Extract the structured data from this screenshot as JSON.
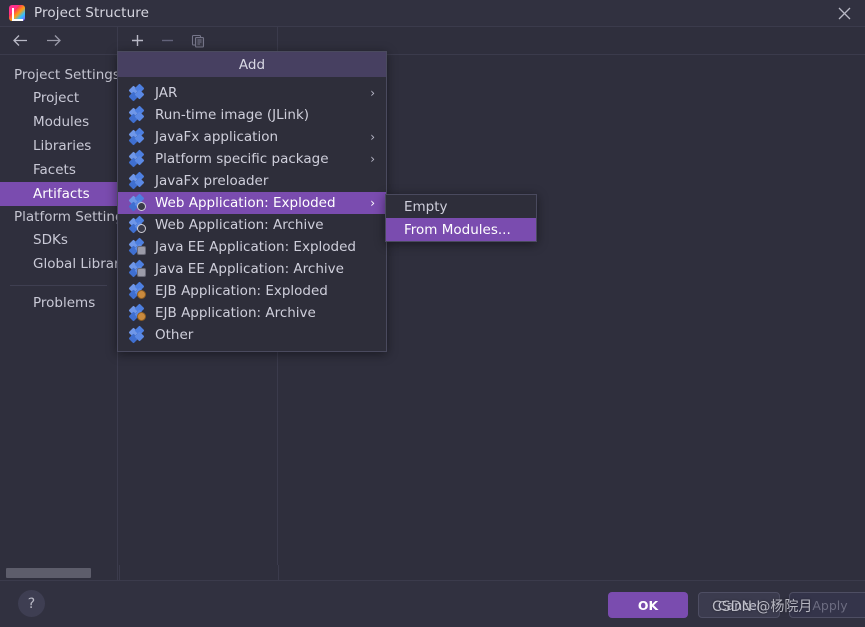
{
  "window": {
    "title": "Project Structure",
    "app_icon": "intellij-idea-icon",
    "close_icon": "close-icon"
  },
  "nav_toolbar": {
    "back_icon": "arrow-left-icon",
    "forward_icon": "arrow-right-icon"
  },
  "sidebar": {
    "groups": [
      {
        "label": "Project Settings",
        "items": [
          {
            "label": "Project",
            "selected": false
          },
          {
            "label": "Modules",
            "selected": false
          },
          {
            "label": "Libraries",
            "selected": false
          },
          {
            "label": "Facets",
            "selected": false
          },
          {
            "label": "Artifacts",
            "selected": true
          }
        ]
      },
      {
        "label": "Platform Settings",
        "items": [
          {
            "label": "SDKs",
            "selected": false
          },
          {
            "label": "Global Libraries",
            "selected": false
          }
        ]
      }
    ],
    "footer_item": {
      "label": "Problems",
      "selected": false
    }
  },
  "list_toolbar": {
    "add_icon": "plus-icon",
    "remove_icon": "minus-icon",
    "copy_icon": "copy-icon"
  },
  "add_menu": {
    "header": "Add",
    "items": [
      {
        "label": "JAR",
        "icon": "artifact-icon",
        "has_submenu": true,
        "selected": false,
        "badge": "none"
      },
      {
        "label": "Run-time image (JLink)",
        "icon": "artifact-icon",
        "has_submenu": false,
        "selected": false,
        "badge": "none"
      },
      {
        "label": "JavaFx application",
        "icon": "artifact-icon",
        "has_submenu": true,
        "selected": false,
        "badge": "none"
      },
      {
        "label": "Platform specific package",
        "icon": "artifact-icon",
        "has_submenu": true,
        "selected": false,
        "badge": "none"
      },
      {
        "label": "JavaFx preloader",
        "icon": "artifact-icon",
        "has_submenu": false,
        "selected": false,
        "badge": "none"
      },
      {
        "label": "Web Application: Exploded",
        "icon": "web-artifact-icon",
        "has_submenu": true,
        "selected": true,
        "badge": "web"
      },
      {
        "label": "Web Application: Archive",
        "icon": "web-artifact-icon",
        "has_submenu": false,
        "selected": false,
        "badge": "web"
      },
      {
        "label": "Java EE Application: Exploded",
        "icon": "javaee-artifact-icon",
        "has_submenu": false,
        "selected": false,
        "badge": "ee"
      },
      {
        "label": "Java EE Application: Archive",
        "icon": "javaee-artifact-icon",
        "has_submenu": false,
        "selected": false,
        "badge": "ee"
      },
      {
        "label": "EJB Application: Exploded",
        "icon": "ejb-artifact-icon",
        "has_submenu": false,
        "selected": false,
        "badge": "ejb"
      },
      {
        "label": "EJB Application: Archive",
        "icon": "ejb-artifact-icon",
        "has_submenu": false,
        "selected": false,
        "badge": "ejb"
      },
      {
        "label": "Other",
        "icon": "artifact-icon",
        "has_submenu": false,
        "selected": false,
        "badge": "none"
      }
    ]
  },
  "sub_menu": {
    "items": [
      {
        "label": "Empty",
        "selected": false
      },
      {
        "label": "From Modules...",
        "selected": true
      }
    ]
  },
  "bottom_bar": {
    "help_label": "?",
    "ok_label": "OK",
    "cancel_label": "Cancel",
    "apply_label": "Apply"
  },
  "watermark": {
    "text": "CSDN @杨院月"
  },
  "colors": {
    "accent_purple": "#7a4caf",
    "header_purple": "#474061",
    "window_bg": "#2f2f3d",
    "titlebar_bg": "#313140",
    "popup_bg": "#2e2e3a",
    "text": "#cfcfdb"
  }
}
